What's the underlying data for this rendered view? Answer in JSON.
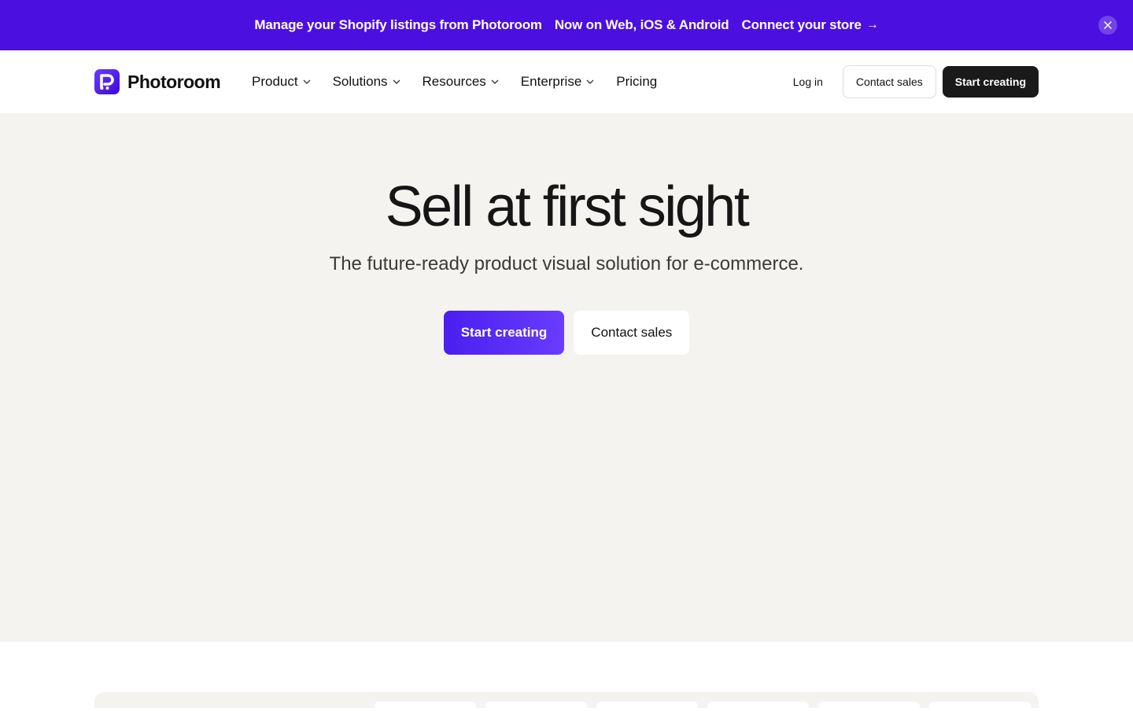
{
  "banner": {
    "message": "Manage your Shopify listings from Photoroom",
    "platforms": "Now on Web, iOS & Android",
    "cta_label": "Connect your store",
    "cta_arrow": "→",
    "background_color": "#4b0fe0"
  },
  "nav": {
    "brand": "Photoroom",
    "menu": [
      {
        "label": "Product",
        "has_dropdown": true
      },
      {
        "label": "Solutions",
        "has_dropdown": true
      },
      {
        "label": "Resources",
        "has_dropdown": true
      },
      {
        "label": "Enterprise",
        "has_dropdown": true
      },
      {
        "label": "Pricing",
        "has_dropdown": false
      }
    ],
    "login_label": "Log in",
    "contact_label": "Contact sales",
    "start_label": "Start creating"
  },
  "hero": {
    "title": "Sell at first sight",
    "subtitle": "The future-ready product visual solution for e-commerce.",
    "primary_cta": "Start creating",
    "secondary_cta": "Contact sales",
    "background_color": "#f4f3f0",
    "accent_color": "#5027f5"
  }
}
